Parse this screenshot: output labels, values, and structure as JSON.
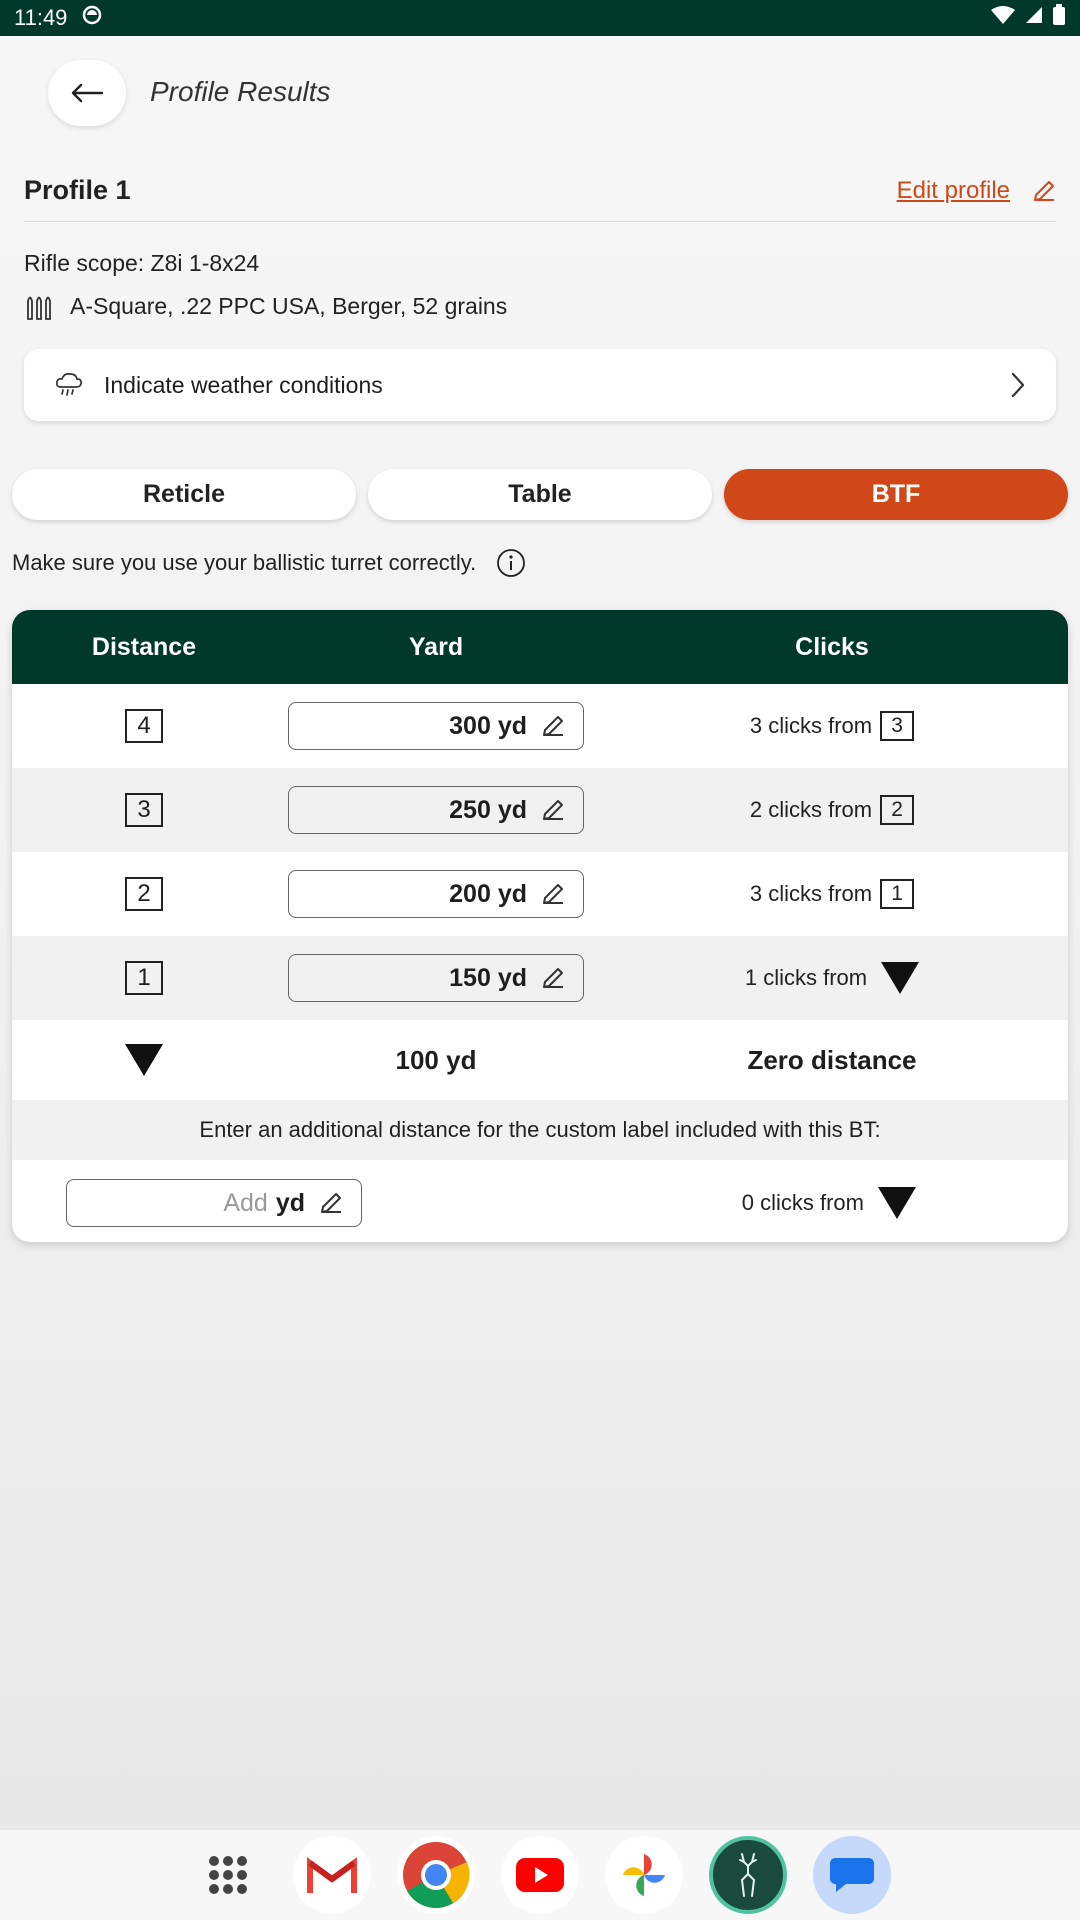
{
  "status_bar": {
    "time": "11:49"
  },
  "header": {
    "title": "Profile Results"
  },
  "profile": {
    "name": "Profile 1",
    "edit_label": "Edit profile"
  },
  "scope": "Rifle scope: Z8i 1-8x24",
  "ammo": "A-Square, .22 PPC USA, Berger, 52 grains",
  "weather": {
    "label": "Indicate weather conditions"
  },
  "tabs": [
    {
      "label": "Reticle",
      "active": false
    },
    {
      "label": "Table",
      "active": false
    },
    {
      "label": "BTF",
      "active": true
    }
  ],
  "info": "Make sure you use your ballistic turret correctly.",
  "table": {
    "headers": {
      "distance": "Distance",
      "yard": "Yard",
      "clicks": "Clicks"
    },
    "rows": [
      {
        "num": "4",
        "yard": "300 yd",
        "clicks_text": "3 clicks from",
        "from": "3"
      },
      {
        "num": "3",
        "yard": "250 yd",
        "clicks_text": "2 clicks from",
        "from": "2"
      },
      {
        "num": "2",
        "yard": "200 yd",
        "clicks_text": "3 clicks from",
        "from": "1"
      },
      {
        "num": "1",
        "yard": "150 yd",
        "clicks_text": "1 clicks from",
        "from": "zero-marker"
      }
    ],
    "zero": {
      "yard": "100 yd",
      "label": "Zero distance"
    },
    "note": "Enter an additional distance for the custom label included with this BT:",
    "add": {
      "placeholder": "Add",
      "unit": "yd",
      "clicks_text": "0 clicks from"
    }
  },
  "colors": {
    "primary_green": "#00382a",
    "accent": "#d04818"
  }
}
